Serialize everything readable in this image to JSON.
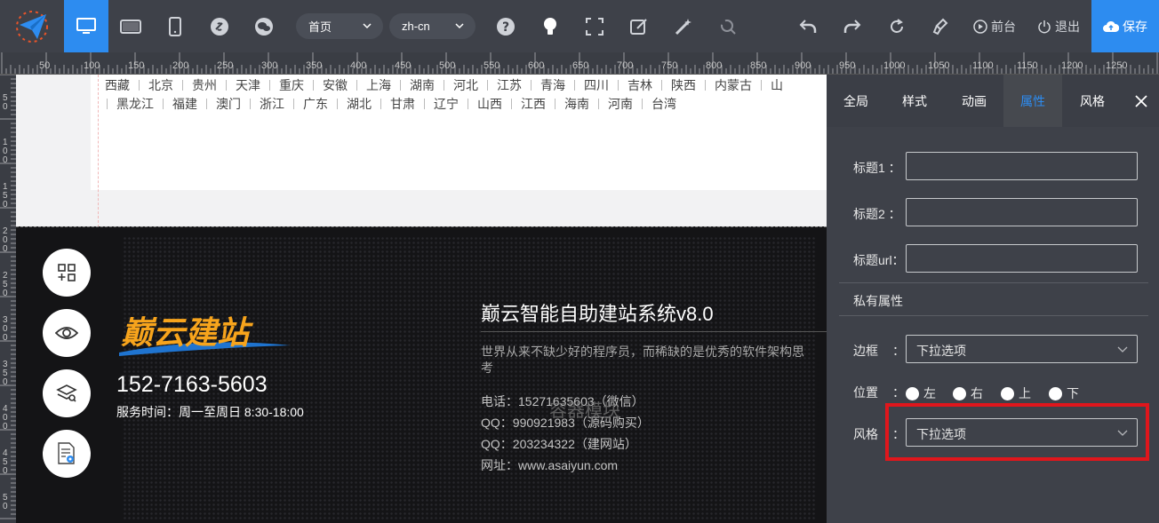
{
  "toolbar": {
    "page_select": "首页",
    "lang_select": "zh-cn",
    "frontend_label": "前台",
    "logout_label": "退出",
    "save_label": "保存",
    "device_icons": [
      "desktop-icon",
      "tablet-icon",
      "phone-icon"
    ]
  },
  "ruler": {
    "h_labels": [
      "50",
      "100",
      "150",
      "200",
      "250",
      "300",
      "350",
      "400",
      "450",
      "500",
      "550",
      "600",
      "650",
      "700",
      "750",
      "800",
      "850",
      "900",
      "950",
      "1000",
      "1050",
      "1100",
      "1150",
      "1200",
      "1250"
    ],
    "v_labels": [
      "5 0",
      "1 0 0",
      "1 5 0",
      "2 0 0",
      "2 5 0",
      "3 0 0",
      "3 5 0",
      "4 0 0",
      "4 5 0",
      "5 0"
    ]
  },
  "canvas": {
    "provinces_row1": [
      "西藏",
      "北京",
      "贵州",
      "天津",
      "重庆",
      "安徽",
      "上海",
      "湖南",
      "河北",
      "江苏",
      "青海",
      "四川",
      "吉林",
      "陕西",
      "内蒙古",
      "山"
    ],
    "provinces_row2": [
      "黑龙江",
      "福建",
      "澳门",
      "浙江",
      "广东",
      "湖北",
      "甘肃",
      "辽宁",
      "山西",
      "江西",
      "海南",
      "河南",
      "台湾"
    ],
    "footer": {
      "logo_text": "巅云建站",
      "phone": "152-7163-5603",
      "service_hours": "服务时间：周一至周日 8:30-18:00",
      "title": "巅云智能自助建站系统v8.0",
      "desc_line1": "世界从来不缺少好的程序员，而稀缺的是优秀的软件架构思",
      "desc_line2": "考",
      "contact_tel": "电话：15271635603（微信）",
      "contact_qq1": "QQ：990921983（源码购买）",
      "contact_qq2": "QQ：203234322（建网站）",
      "contact_web": "网址：www.asaiyun.com",
      "overlay_label": "容器模块"
    }
  },
  "panel": {
    "tabs": [
      "全局",
      "样式",
      "动画",
      "属性",
      "风格"
    ],
    "active_tab": "属性",
    "title1_label": "标题1 ：",
    "title2_label": "标题2 ：",
    "titleurl_label": "标题url：",
    "section_label": "私有属性",
    "border_label": "边框",
    "border_select": "下拉选项",
    "position_label": "位置",
    "positions": [
      "左",
      "右",
      "上",
      "下"
    ],
    "style_label": "风格",
    "style_select": "下拉选项",
    "colon": "："
  }
}
